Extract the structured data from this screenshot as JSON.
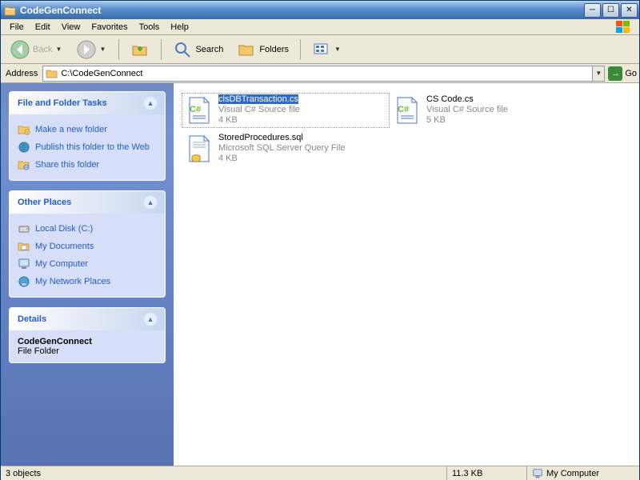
{
  "window": {
    "title": "CodeGenConnect"
  },
  "menu": {
    "file": "File",
    "edit": "Edit",
    "view": "View",
    "favorites": "Favorites",
    "tools": "Tools",
    "help": "Help"
  },
  "toolbar": {
    "back": "Back",
    "search": "Search",
    "folders": "Folders"
  },
  "addressbar": {
    "label": "Address",
    "path": "C:\\CodeGenConnect",
    "go": "Go"
  },
  "tasks": {
    "title": "File and Folder Tasks",
    "items": [
      {
        "label": "Make a new folder",
        "icon": "folder-new"
      },
      {
        "label": "Publish this folder to the Web",
        "icon": "globe"
      },
      {
        "label": "Share this folder",
        "icon": "share-folder"
      }
    ]
  },
  "places": {
    "title": "Other Places",
    "items": [
      {
        "label": "Local Disk (C:)",
        "icon": "disk"
      },
      {
        "label": "My Documents",
        "icon": "docs"
      },
      {
        "label": "My Computer",
        "icon": "computer"
      },
      {
        "label": "My Network Places",
        "icon": "network"
      }
    ]
  },
  "details": {
    "title": "Details",
    "name": "CodeGenConnect",
    "type": "File Folder"
  },
  "files": [
    {
      "name": "clsDBTransaction.cs",
      "type": "Visual C# Source file",
      "size": "4 KB",
      "icon": "cs",
      "selected": true
    },
    {
      "name": "CS Code.cs",
      "type": "Visual C# Source file",
      "size": "5 KB",
      "icon": "cs",
      "selected": false
    },
    {
      "name": "StoredProcedures.sql",
      "type": "Microsoft SQL Server Query File",
      "size": "4 KB",
      "icon": "sql",
      "selected": false
    }
  ],
  "statusbar": {
    "count": "3 objects",
    "size": "11.3 KB",
    "zone": "My Computer"
  }
}
